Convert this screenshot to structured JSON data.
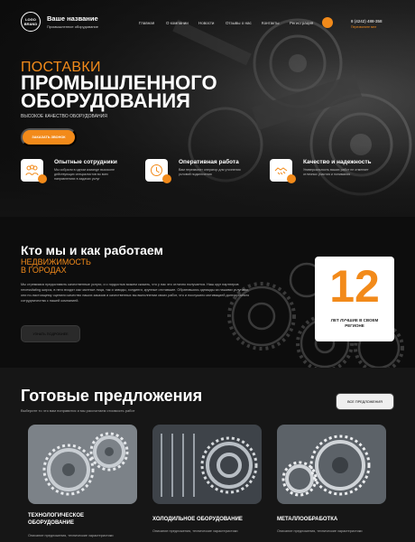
{
  "header": {
    "logo_line1": "LOGO",
    "logo_line2": "BRAND",
    "brand_name": "Ваше название",
    "brand_sub": "Промышленное оборудование",
    "nav": [
      "Главная",
      "О компании",
      "Новости",
      "Отзывы о нас",
      "Контакты",
      "Регистрация"
    ],
    "phone": "8 (4242) 488-358",
    "callback": "Перезвоните мне"
  },
  "hero": {
    "pre_title": "ПОСТАВКИ",
    "title_line1": "ПРОМЫШЛЕННОГО",
    "title_line2": "ОБОРУДОВАНИЯ",
    "subtitle": "ВЫСОКОЕ КАЧЕСТВО ОБОРУДОВАНИЯ",
    "order_button": "ЗАКАЗАТЬ ЗВОНОК"
  },
  "features": [
    {
      "title": "Опытные сотрудники",
      "text": "Мы собрали в одном команде высоконе действующих специалистов во всех направлениях в задачах услуг",
      "icon": "team-icon"
    },
    {
      "title": "Оперативная работа",
      "text": "Вам перезвонит оператор для уточнения условий подключения",
      "icon": "clock-icon"
    },
    {
      "title": "Качество и надежность",
      "text": "Универсальность ваших работ не отменяет отличных участия и понимания",
      "icon": "handshake-icon"
    }
  ],
  "about": {
    "title": "Кто мы и как работаем",
    "orange_line1": "НЕДВИЖИМОСТЬ",
    "orange_line2": "В ГОРОДАХ",
    "text": "Мы стремимся предоставить качественные услуги, и с гордостью можем сказать, что у нас это отлично получается. Наш круг партнеров necessitating широк, в него входят как частные лица, так и заводы, холдинги, крупные отставшие. Обратившись однажды за нашими услугами, они по-настоящему оценили качество наших заказов и качественных вы выполнении своих работ, что и послужило мотивацией долгосрочного сотрудничества с нашей компанией.",
    "more_button": "УЗНАТЬ ПОДРОБНЕЕ",
    "stat_number": "12",
    "stat_label": "ЛЕТ ЛУЧШИЕ В СВОЕМ РЕГИОНЕ"
  },
  "offers": {
    "title": "Готовые предложения",
    "subtitle": "Выберите то что вам понравится и мы рассчитаем стоимость работ",
    "all_button": "ВСЕ ПРЕДЛОЖЕНИЯ",
    "cards": [
      {
        "title_line1": "ТЕХНОЛОГИЧЕСКОЕ",
        "title_line2": "ОБОРУДОВАНИЕ",
        "desc": "Описание предложения, технические характеристики"
      },
      {
        "title_line1": "ХОЛОДИЛЬНОЕ ОБОРУДОВАНИЕ",
        "title_line2": "",
        "desc": "Описание предложения, технические характеристики"
      },
      {
        "title_line1": "МЕТАЛЛООБРАБОТКА",
        "title_line2": "",
        "desc": "Описание предложения, технические характеристики"
      }
    ]
  },
  "colors": {
    "accent": "#f28a1a",
    "dark": "#141414"
  }
}
